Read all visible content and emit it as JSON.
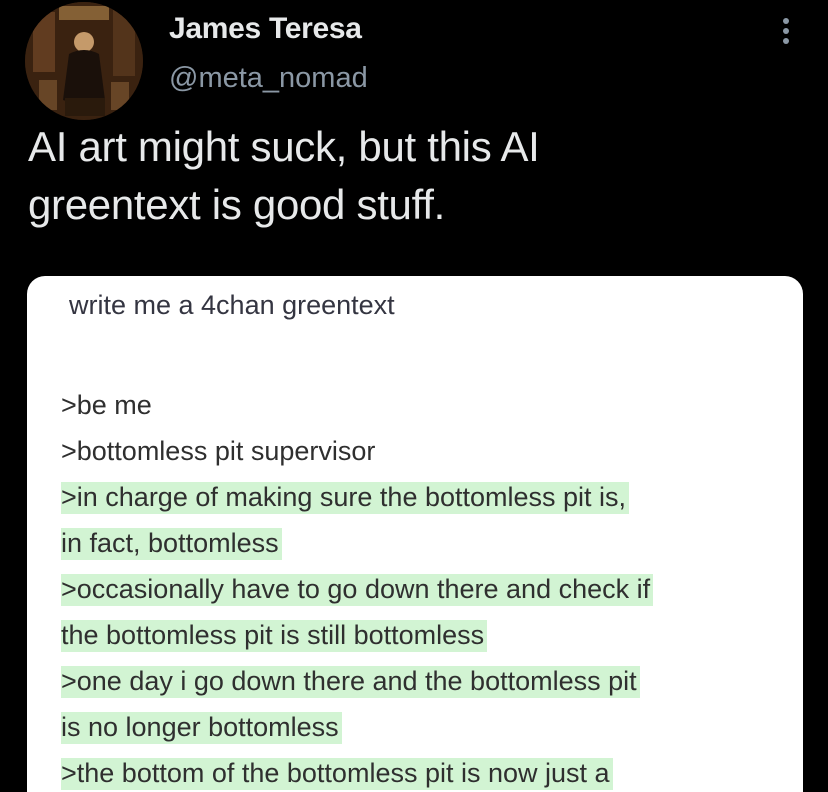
{
  "author": {
    "display_name": "James Teresa",
    "handle": "@meta_nomad",
    "avatar": "avatar-painting"
  },
  "header": {
    "more_icon": "more-vertical-icon"
  },
  "tweet": {
    "text_line_1": "AI art might suck, but this AI",
    "text_line_2": "greentext is good stuff."
  },
  "media": {
    "prompt": "write me a 4chan greentext",
    "lines": [
      {
        "text": ">be me",
        "highlighted": false
      },
      {
        "text": ">bottomless pit supervisor",
        "highlighted": false
      },
      {
        "text": ">in charge of making sure the bottomless pit is,",
        "highlighted": true
      },
      {
        "text": "in fact, bottomless",
        "highlighted": true
      },
      {
        "text": ">occasionally have to go down there and check if",
        "highlighted": true
      },
      {
        "text": " the bottomless pit is still bottomless",
        "highlighted": true
      },
      {
        "text": ">one day i go down there and the bottomless pit",
        "highlighted": true
      },
      {
        "text": "is no longer bottomless",
        "highlighted": true
      },
      {
        "text": ">the bottom of the bottomless pit is now just a",
        "highlighted": true
      }
    ],
    "highlight_color": "#d2f4d3"
  },
  "colors": {
    "background": "#000000",
    "primary_text": "#e7e9ea",
    "secondary_text": "#8b98a5",
    "card_background": "#ffffff"
  }
}
